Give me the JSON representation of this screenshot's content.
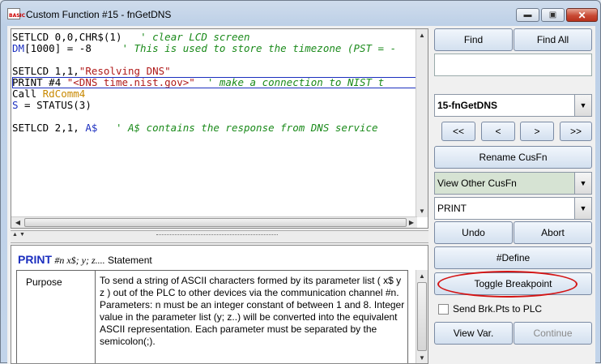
{
  "window": {
    "title": "Custom Function #15 - fnGetDNS",
    "minimize_symbol": "▬",
    "maximize_symbol": "▣",
    "close_symbol": "✕"
  },
  "editor": {
    "lines": [
      [
        {
          "t": "SETLCD",
          "c": "kw"
        },
        {
          "t": " 0,0,",
          "c": "kw"
        },
        {
          "t": "CHR$",
          "c": "kw"
        },
        {
          "t": "(1)  ",
          "c": "kw"
        },
        {
          "t": " ' clear LCD screen",
          "c": "cm"
        }
      ],
      [
        {
          "t": "DM",
          "c": "var"
        },
        {
          "t": "[1000] = -8     ",
          "c": "kw"
        },
        {
          "t": "' This is used to store the timezone (PST = -",
          "c": "cm"
        }
      ],
      [],
      [
        {
          "t": "SETLCD",
          "c": "kw"
        },
        {
          "t": " 1,1,",
          "c": "kw"
        },
        {
          "t": "\"Resolving DNS\"",
          "c": "str"
        }
      ],
      [
        {
          "t": "PRINT",
          "c": "kw"
        },
        {
          "t": " #4 ",
          "c": "kw"
        },
        {
          "t": "\"<DNS time.nist.gov>\"",
          "c": "str"
        },
        {
          "t": "  ' make a connection to NIST t",
          "c": "cm"
        }
      ],
      [
        {
          "t": "Call",
          "c": "kw"
        },
        {
          "t": " RdComm4",
          "c": "sub"
        }
      ],
      [
        {
          "t": "S",
          "c": "var"
        },
        {
          "t": " = ",
          "c": "kw"
        },
        {
          "t": "STATUS",
          "c": "kw"
        },
        {
          "t": "(3)",
          "c": "kw"
        }
      ],
      [],
      [
        {
          "t": "SETLCD",
          "c": "kw"
        },
        {
          "t": " 2,1, ",
          "c": "kw"
        },
        {
          "t": "A$",
          "c": "var"
        },
        {
          "t": "   ' A$ contains the response from DNS service",
          "c": "cm"
        }
      ]
    ]
  },
  "help": {
    "command": "PRINT",
    "params": "#n  x$; y; z....",
    "kind": "Statement",
    "row_label": "Purpose",
    "paragraphs": [
      "To send a string of ASCII characters formed by its parameter list ( x$ y  z ) out of the PLC to other devices via the communication channel #n.",
      "Parameters: n must be an integer constant of between 1 and 8. Integer value in the parameter list (y; z..) will be converted into the equivalent ASCII representation. Each parameter must be separated by the semicolon(;)."
    ]
  },
  "right": {
    "find": "Find",
    "find_all": "Find All",
    "search_value": "",
    "function_select": "15-fnGetDNS",
    "nav": [
      "<<",
      "<",
      ">",
      ">>"
    ],
    "rename": "Rename CusFn",
    "view_other": "View Other CusFn",
    "keyword_select": "PRINT",
    "undo": "Undo",
    "abort": "Abort",
    "define": "#Define",
    "toggle_breakpoint": "Toggle Breakpoint",
    "send_brk_label": "Send Brk.Pts to PLC",
    "send_brk_checked": false,
    "view_var": "View Var.",
    "continue": "Continue"
  },
  "colors": {
    "keyword": "#000000",
    "comment": "#1a8a1a",
    "string": "#b01a1a",
    "variable": "#1c2fbf",
    "subroutine": "#c88800",
    "highlight_ellipse": "#d41414"
  }
}
